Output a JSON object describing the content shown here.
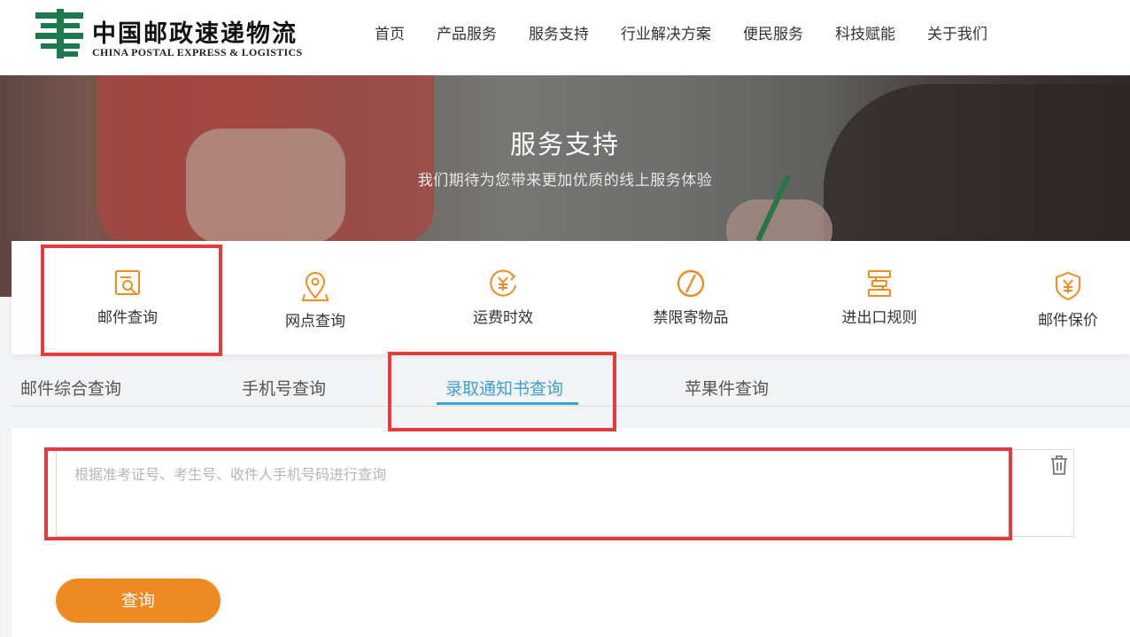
{
  "header": {
    "logo_cn": "中国邮政速递物流",
    "logo_en": "CHINA POSTAL EXPRESS & LOGISTICS",
    "nav": [
      {
        "label": "首页"
      },
      {
        "label": "产品服务"
      },
      {
        "label": "服务支持"
      },
      {
        "label": "行业解决方案"
      },
      {
        "label": "便民服务"
      },
      {
        "label": "科技赋能"
      },
      {
        "label": "关于我们"
      }
    ]
  },
  "banner": {
    "title": "服务支持",
    "subtitle": "我们期待为您带来更加优质的线上服务体验"
  },
  "services": [
    {
      "label": "邮件查询",
      "icon": "mail-search-icon"
    },
    {
      "label": "网点查询",
      "icon": "location-pin-icon"
    },
    {
      "label": "运费时效",
      "icon": "yuan-clock-icon"
    },
    {
      "label": "禁限寄物品",
      "icon": "forbidden-icon"
    },
    {
      "label": "进出口规则",
      "icon": "rules-icon"
    },
    {
      "label": "邮件保价",
      "icon": "shield-yuan-icon"
    }
  ],
  "tabs": [
    {
      "label": "邮件综合查询"
    },
    {
      "label": "手机号查询"
    },
    {
      "label": "录取通知书查询"
    },
    {
      "label": "苹果件查询"
    }
  ],
  "active_tab": "录取通知书查询",
  "query": {
    "placeholder": "根据准考证号、考生号、收件人手机号码进行查询",
    "value": "",
    "button_label": "查询"
  },
  "colors": {
    "accent_blue": "#3aa0d8",
    "icon_orange": "#f08c1e",
    "button_orange": "#ef8a22",
    "highlight_red": "#e23c3c",
    "logo_green": "#1d7a4f"
  }
}
